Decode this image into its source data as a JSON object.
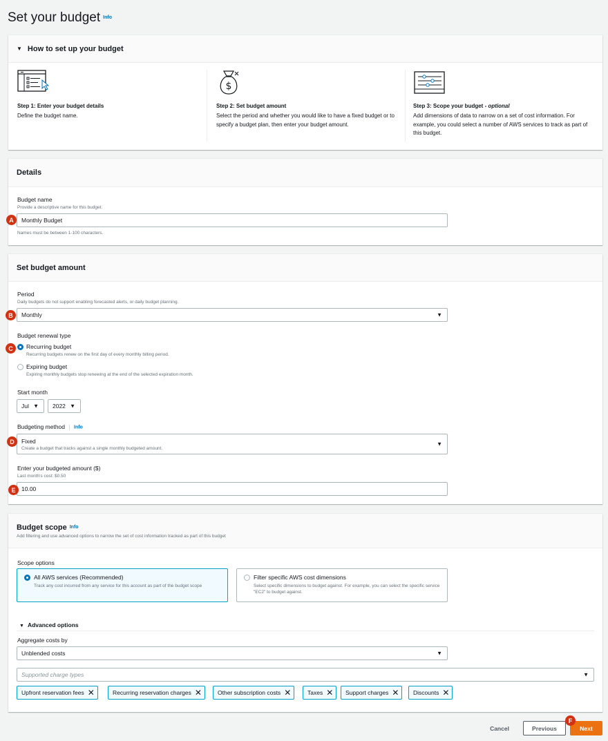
{
  "page": {
    "title": "Set your budget",
    "info": "Info"
  },
  "howto": {
    "title": "How to set up your budget",
    "steps": [
      {
        "title": "Step 1: Enter your budget details",
        "desc": "Define the budget name."
      },
      {
        "title": "Step 2: Set budget amount",
        "desc": "Select the period and whether you would like to have a fixed budget or to specify a budget plan, then enter your budget amount."
      },
      {
        "title_prefix": "Step 3: Scope your budget - ",
        "title_em": "optional",
        "desc": "Add dimensions of data to narrow on a set of cost information. For example, you could select a number of AWS services to track as part of this budget."
      }
    ]
  },
  "details": {
    "title": "Details",
    "name_label": "Budget name",
    "name_desc": "Provide a descriptive name for this budget.",
    "name_value": "Monthly Budget",
    "name_hint": "Names must be between 1-100 characters."
  },
  "amount": {
    "title": "Set budget amount",
    "period_label": "Period",
    "period_desc": "Daily budgets do not support enabling forecasted alerts, or daily budget planning.",
    "period_value": "Monthly",
    "renewal_label": "Budget renewal type",
    "recurring_label": "Recurring budget",
    "recurring_desc": "Recurring budgets renew on the first day of every monthly billing period.",
    "expiring_label": "Expiring budget",
    "expiring_desc": "Expiring monthly budgets stop renewing at the end of the selected expiration month.",
    "start_label": "Start month",
    "start_month": "Jul",
    "start_year": "2022",
    "method_label": "Budgeting method",
    "method_info": "Info",
    "method_value": "Fixed",
    "method_desc": "Create a budget that tracks against a single monthly budgeted amount.",
    "amount_label": "Enter your budgeted amount ($)",
    "amount_desc": "Last month's cost: $0.50",
    "amount_value": "10.00"
  },
  "scope": {
    "title": "Budget scope",
    "info": "Info",
    "desc": "Add filtering and use advanced options to narrow the set of cost information tracked as part of this budget",
    "options_label": "Scope options",
    "all_label": "All AWS services (Recommended)",
    "all_desc": "Track any cost incurred from any service for this account as part of the budget scope",
    "filter_label": "Filter specific AWS cost dimensions",
    "filter_desc": "Select specific dimensions to budget against. For example, you can select the specific service \"EC2\" to budget against.",
    "advanced_label": "Advanced options",
    "aggregate_label": "Aggregate costs by",
    "aggregate_value": "Unblended costs",
    "charge_placeholder": "Supported charge types",
    "tokens": [
      "Upfront reservation fees",
      "Recurring reservation charges",
      "Other subscription costs",
      "Taxes",
      "Support charges",
      "Discounts"
    ]
  },
  "footer": {
    "cancel": "Cancel",
    "previous": "Previous",
    "next": "Next"
  },
  "markers": {
    "a": "A",
    "b": "B",
    "c": "C",
    "d": "D",
    "e": "E",
    "f": "F"
  },
  "colors": {
    "accent": "#0073bb",
    "primary_button": "#ec7211",
    "marker": "#d13212",
    "token_border": "#00a1c9"
  }
}
